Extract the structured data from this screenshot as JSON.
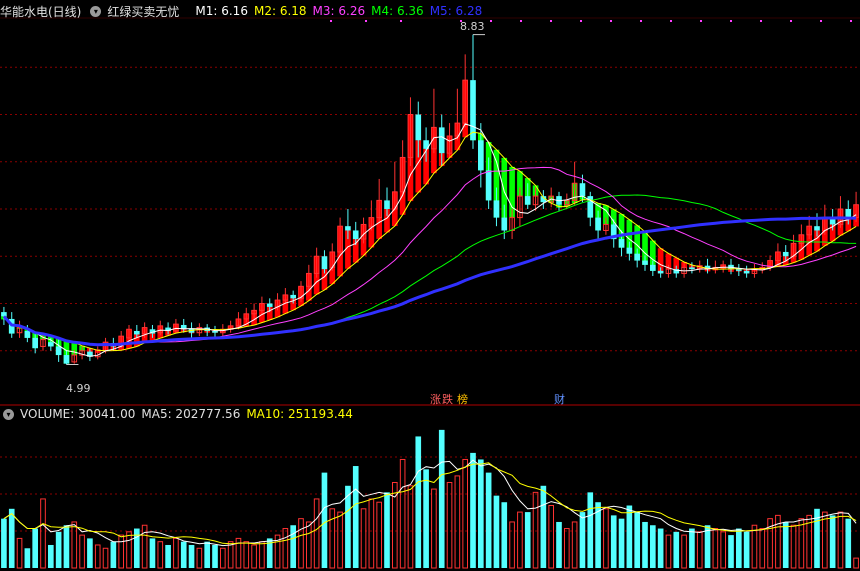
{
  "header": {
    "stock_name": "华能水电(日线)",
    "indicator_name": "红绿买卖无忧",
    "ma": [
      {
        "label": "M1: 6.16",
        "color": "#ffffff"
      },
      {
        "label": "M2: 6.18",
        "color": "#ffff00"
      },
      {
        "label": "M3: 6.26",
        "color": "#ff40ff"
      },
      {
        "label": "M4: 6.36",
        "color": "#00ff00"
      },
      {
        "label": "M5: 6.28",
        "color": "#3030ff"
      }
    ]
  },
  "volume_header": {
    "volume_label": "VOLUME: 30041.00",
    "ma5_label": "MA5: 202777.56",
    "ma10_label": "MA10: 251193.44"
  },
  "annotations": {
    "high_label": "8.83",
    "low_label": "4.99",
    "tag_zhang": "涨",
    "tag_die": "跌",
    "tag_bang": "榜",
    "tag_cai": "财"
  },
  "colors": {
    "up": "#ff3232",
    "down": "#54ffff",
    "red_block": "#ff0000",
    "green_block": "#00ff00",
    "m1": "#ffffff",
    "m2": "#ffff00",
    "m3": "#ff40ff",
    "m4": "#00ff00",
    "m5": "#3030ff",
    "grid": "#8b0000"
  },
  "chart_data": [
    {
      "type": "candlestick",
      "price_range": [
        4.6,
        9.0
      ],
      "high": 8.83,
      "low": 4.99,
      "ohlc": [
        [
          5.6,
          5.55,
          5.66,
          5.45
        ],
        [
          5.52,
          5.35,
          5.6,
          5.3
        ],
        [
          5.36,
          5.42,
          5.5,
          5.3
        ],
        [
          5.38,
          5.3,
          5.45,
          5.25
        ],
        [
          5.3,
          5.18,
          5.35,
          5.12
        ],
        [
          5.2,
          5.28,
          5.33,
          5.15
        ],
        [
          5.25,
          5.2,
          5.3,
          5.15
        ],
        [
          5.2,
          5.1,
          5.28,
          5.02
        ],
        [
          5.1,
          5.0,
          5.15,
          4.99
        ],
        [
          5.02,
          5.1,
          5.16,
          5.0
        ],
        [
          5.1,
          5.15,
          5.2,
          5.05
        ],
        [
          5.14,
          5.08,
          5.18,
          5.03
        ],
        [
          5.08,
          5.16,
          5.2,
          5.05
        ],
        [
          5.15,
          5.25,
          5.3,
          5.12
        ],
        [
          5.24,
          5.2,
          5.3,
          5.15
        ],
        [
          5.2,
          5.32,
          5.38,
          5.18
        ],
        [
          5.3,
          5.4,
          5.45,
          5.28
        ],
        [
          5.38,
          5.34,
          5.45,
          5.3
        ],
        [
          5.35,
          5.42,
          5.48,
          5.3
        ],
        [
          5.4,
          5.35,
          5.45,
          5.3
        ],
        [
          5.36,
          5.44,
          5.5,
          5.33
        ],
        [
          5.42,
          5.38,
          5.48,
          5.34
        ],
        [
          5.38,
          5.46,
          5.52,
          5.35
        ],
        [
          5.45,
          5.4,
          5.52,
          5.36
        ],
        [
          5.41,
          5.36,
          5.48,
          5.3
        ],
        [
          5.36,
          5.42,
          5.47,
          5.32
        ],
        [
          5.42,
          5.38,
          5.46,
          5.32
        ],
        [
          5.38,
          5.36,
          5.44,
          5.3
        ],
        [
          5.36,
          5.4,
          5.46,
          5.32
        ],
        [
          5.4,
          5.44,
          5.5,
          5.36
        ],
        [
          5.44,
          5.52,
          5.6,
          5.4
        ],
        [
          5.52,
          5.58,
          5.65,
          5.48
        ],
        [
          5.58,
          5.62,
          5.7,
          5.52
        ],
        [
          5.62,
          5.7,
          5.78,
          5.58
        ],
        [
          5.7,
          5.66,
          5.76,
          5.6
        ],
        [
          5.66,
          5.74,
          5.82,
          5.62
        ],
        [
          5.74,
          5.8,
          5.88,
          5.7
        ],
        [
          5.8,
          5.76,
          5.85,
          5.7
        ],
        [
          5.76,
          5.9,
          5.96,
          5.72
        ],
        [
          5.9,
          6.05,
          6.15,
          5.86
        ],
        [
          6.05,
          6.25,
          6.35,
          6.0
        ],
        [
          6.25,
          6.1,
          6.32,
          6.05
        ],
        [
          6.12,
          6.3,
          6.4,
          6.08
        ],
        [
          6.3,
          6.6,
          6.7,
          6.25
        ],
        [
          6.6,
          6.55,
          6.8,
          6.45
        ],
        [
          6.55,
          6.45,
          6.65,
          6.38
        ],
        [
          6.45,
          6.62,
          6.7,
          6.4
        ],
        [
          6.6,
          6.7,
          6.9,
          6.55
        ],
        [
          6.7,
          6.9,
          7.15,
          6.65
        ],
        [
          6.9,
          6.8,
          7.05,
          6.72
        ],
        [
          6.8,
          7.0,
          7.35,
          6.78
        ],
        [
          7.0,
          7.4,
          7.6,
          6.95
        ],
        [
          7.4,
          7.9,
          8.1,
          7.3
        ],
        [
          7.9,
          7.6,
          8.05,
          7.4
        ],
        [
          7.6,
          7.5,
          7.75,
          7.35
        ],
        [
          7.5,
          7.75,
          8.2,
          7.45
        ],
        [
          7.75,
          7.45,
          7.9,
          7.3
        ],
        [
          7.45,
          7.65,
          7.8,
          7.4
        ],
        [
          7.65,
          7.8,
          8.2,
          7.6
        ],
        [
          7.8,
          8.3,
          8.6,
          7.75
        ],
        [
          8.3,
          7.6,
          8.83,
          7.5
        ],
        [
          7.6,
          7.25,
          7.8,
          7.05
        ],
        [
          7.25,
          6.9,
          7.4,
          6.8
        ],
        [
          6.9,
          6.7,
          7.05,
          6.6
        ],
        [
          6.7,
          6.55,
          6.85,
          6.45
        ],
        [
          6.55,
          6.7,
          6.8,
          6.45
        ],
        [
          6.7,
          6.95,
          7.05,
          6.6
        ],
        [
          6.95,
          6.85,
          7.1,
          6.8
        ],
        [
          6.85,
          6.95,
          7.05,
          6.78
        ],
        [
          6.95,
          6.88,
          7.02,
          6.8
        ],
        [
          6.88,
          6.95,
          7.05,
          6.82
        ],
        [
          6.95,
          6.85,
          7.0,
          6.78
        ],
        [
          6.85,
          6.9,
          6.98,
          6.8
        ],
        [
          6.9,
          7.1,
          7.35,
          6.85
        ],
        [
          7.1,
          6.95,
          7.2,
          6.88
        ],
        [
          6.95,
          6.7,
          7.0,
          6.6
        ],
        [
          6.7,
          6.55,
          6.78,
          6.45
        ],
        [
          6.55,
          6.62,
          6.7,
          6.5
        ],
        [
          6.62,
          6.45,
          6.68,
          6.35
        ],
        [
          6.45,
          6.35,
          6.55,
          6.25
        ],
        [
          6.35,
          6.28,
          6.42,
          6.2
        ],
        [
          6.28,
          6.2,
          6.34,
          6.12
        ],
        [
          6.2,
          6.15,
          6.26,
          6.08
        ],
        [
          6.15,
          6.08,
          6.2,
          6.02
        ],
        [
          6.08,
          6.05,
          6.12,
          6.0
        ],
        [
          6.05,
          6.1,
          6.15,
          6.0
        ],
        [
          6.1,
          6.05,
          6.14,
          6.0
        ],
        [
          6.05,
          6.12,
          6.18,
          6.0
        ],
        [
          6.12,
          6.1,
          6.18,
          6.05
        ],
        [
          6.1,
          6.14,
          6.2,
          6.06
        ],
        [
          6.14,
          6.1,
          6.22,
          6.05
        ],
        [
          6.1,
          6.12,
          6.2,
          6.05
        ],
        [
          6.12,
          6.15,
          6.2,
          6.06
        ],
        [
          6.15,
          6.1,
          6.22,
          6.04
        ],
        [
          6.1,
          6.08,
          6.16,
          6.02
        ],
        [
          6.08,
          6.05,
          6.14,
          6.0
        ],
        [
          6.05,
          6.1,
          6.16,
          6.0
        ],
        [
          6.1,
          6.12,
          6.18,
          6.05
        ],
        [
          6.12,
          6.2,
          6.26,
          6.08
        ],
        [
          6.2,
          6.3,
          6.4,
          6.15
        ],
        [
          6.3,
          6.25,
          6.38,
          6.2
        ],
        [
          6.25,
          6.4,
          6.5,
          6.22
        ],
        [
          6.4,
          6.5,
          6.62,
          6.35
        ],
        [
          6.5,
          6.6,
          6.72,
          6.45
        ],
        [
          6.6,
          6.55,
          6.75,
          6.48
        ],
        [
          6.55,
          6.7,
          6.85,
          6.5
        ],
        [
          6.7,
          6.62,
          6.8,
          6.55
        ],
        [
          6.62,
          6.8,
          6.95,
          6.58
        ],
        [
          6.8,
          6.7,
          6.9,
          6.62
        ],
        [
          6.7,
          6.85,
          7.0,
          6.65
        ]
      ],
      "blocks": {
        "red_ranges": [
          [
            11,
            59
          ],
          [
            84,
            109
          ]
        ],
        "green_ranges": [
          [
            0,
            10
          ],
          [
            60,
            83
          ]
        ]
      }
    },
    {
      "type": "volume",
      "volume_max": 450000,
      "volumes": [
        150000,
        180000,
        90000,
        60000,
        120000,
        210000,
        70000,
        110000,
        130000,
        140000,
        100000,
        90000,
        70000,
        60000,
        80000,
        100000,
        110000,
        120000,
        130000,
        90000,
        80000,
        70000,
        90000,
        80000,
        70000,
        60000,
        80000,
        70000,
        60000,
        80000,
        90000,
        80000,
        70000,
        80000,
        90000,
        100000,
        120000,
        130000,
        150000,
        140000,
        210000,
        290000,
        180000,
        170000,
        250000,
        310000,
        180000,
        210000,
        200000,
        230000,
        260000,
        330000,
        250000,
        400000,
        300000,
        240000,
        420000,
        260000,
        280000,
        330000,
        350000,
        330000,
        290000,
        220000,
        200000,
        140000,
        170000,
        170000,
        230000,
        250000,
        190000,
        140000,
        120000,
        140000,
        170000,
        230000,
        200000,
        180000,
        160000,
        150000,
        190000,
        170000,
        140000,
        130000,
        120000,
        100000,
        110000,
        100000,
        120000,
        110000,
        130000,
        120000,
        110000,
        100000,
        120000,
        110000,
        130000,
        120000,
        150000,
        160000,
        140000,
        130000,
        150000,
        160000,
        180000,
        170000,
        160000,
        170000,
        150000,
        30041
      ]
    }
  ]
}
